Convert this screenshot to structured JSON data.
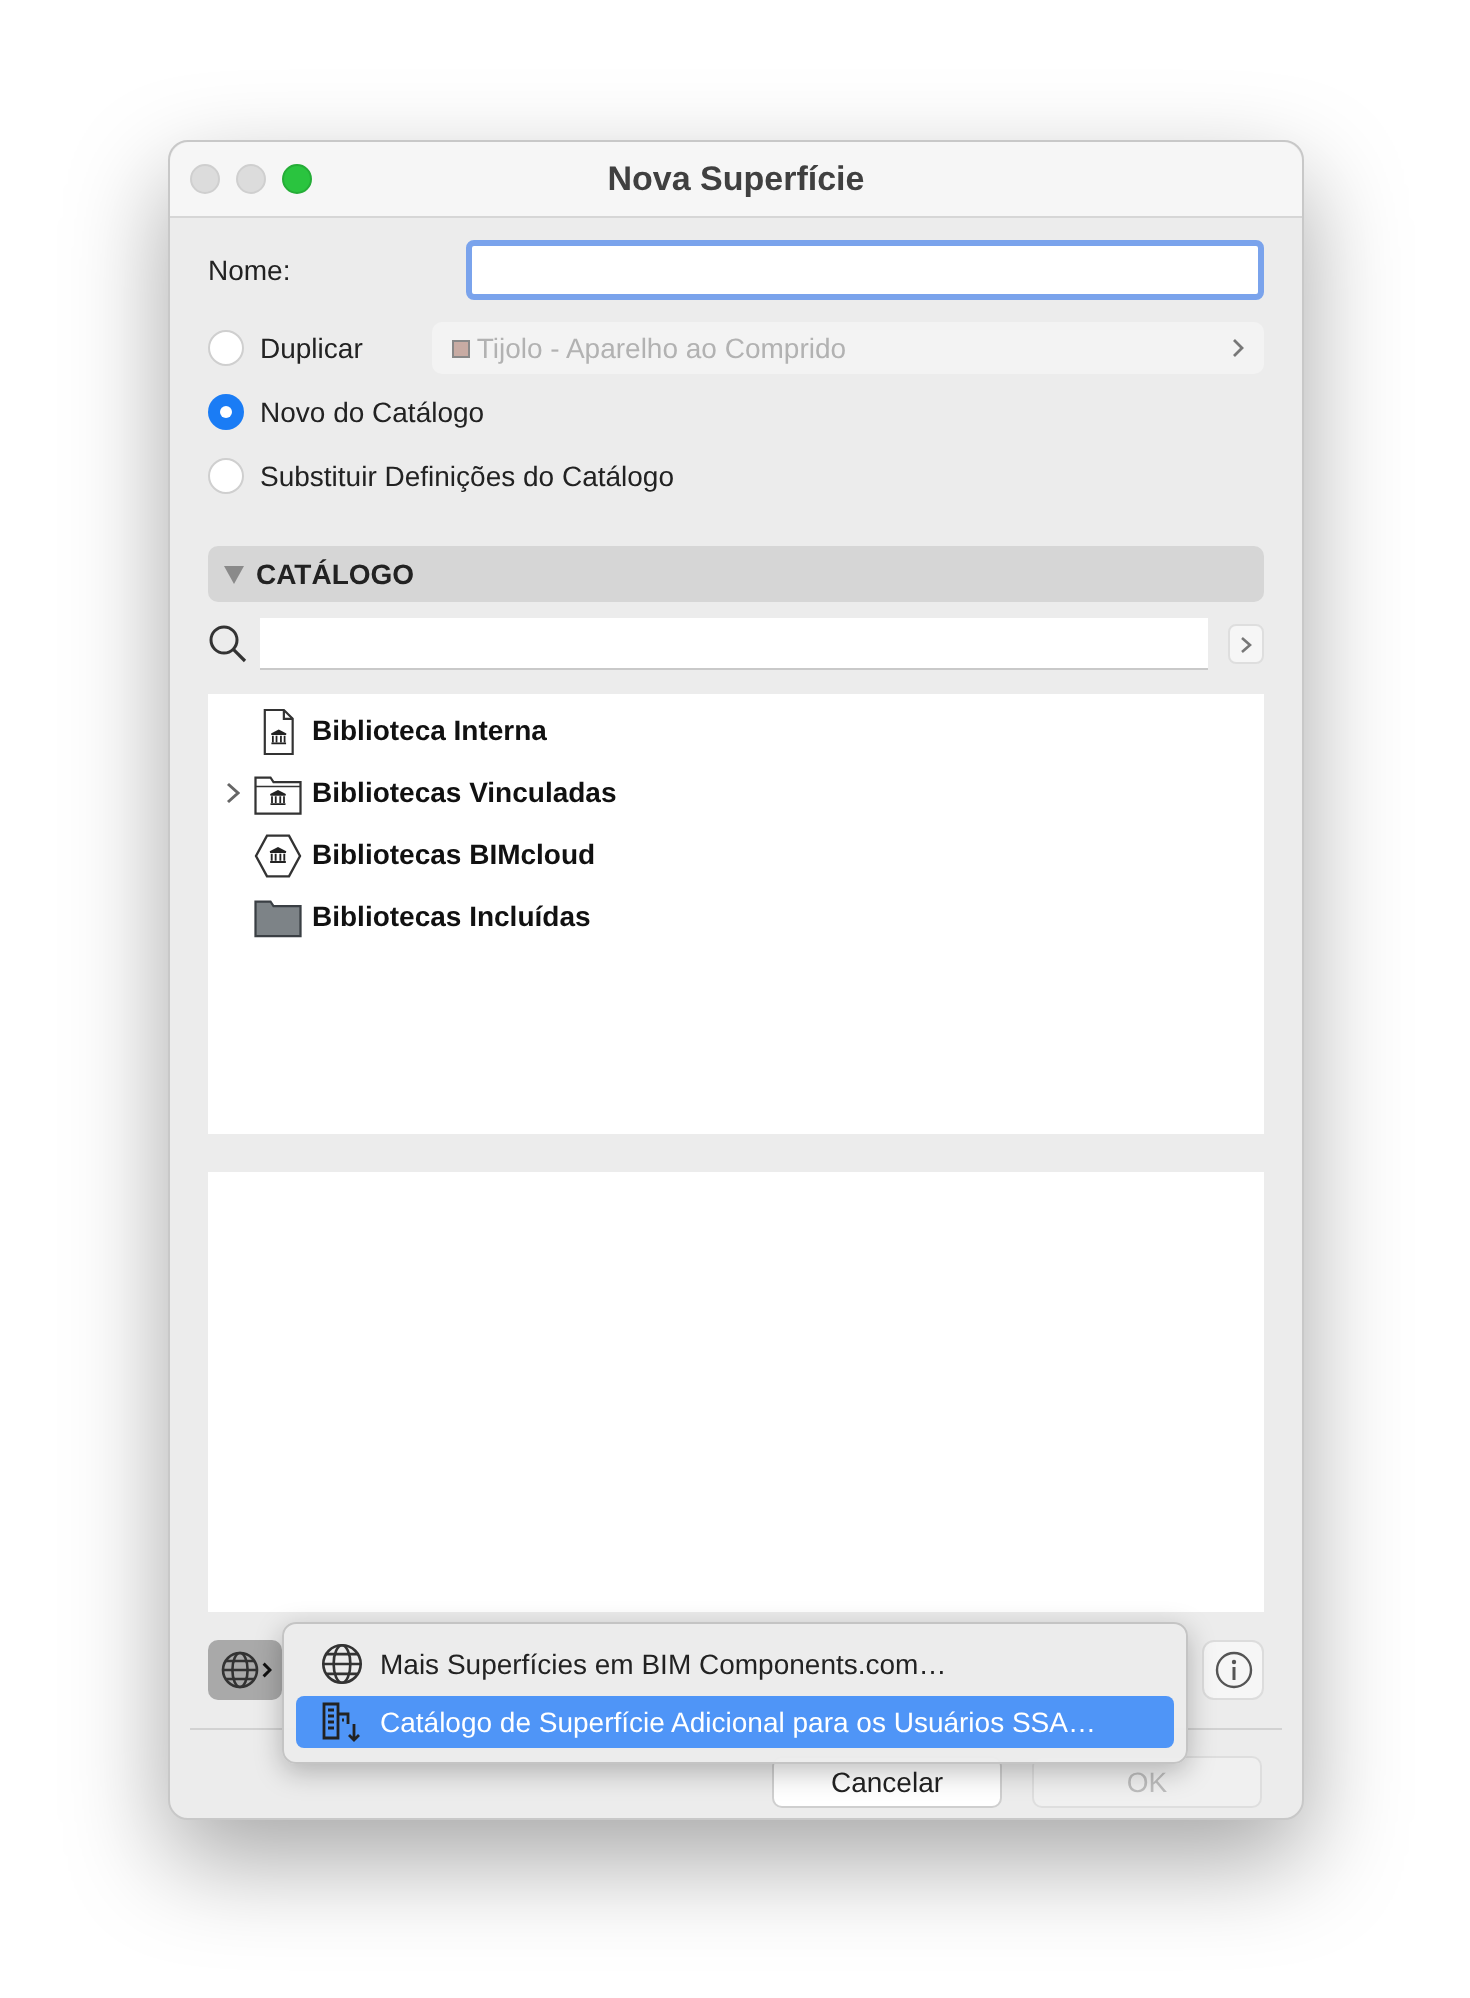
{
  "window": {
    "title": "Nova Superfície"
  },
  "name_field": {
    "label": "Nome:",
    "focused": true
  },
  "options": [
    {
      "label": "Duplicar",
      "selected": false
    },
    {
      "label": "Novo do Catálogo",
      "selected": true
    },
    {
      "label": "Substituir Definições do Catálogo",
      "selected": false
    }
  ],
  "duplicate_select": {
    "value": "Tijolo - Aparelho ao Comprido",
    "color": "#c8aba3",
    "disabled": true
  },
  "catalog": {
    "title": "CATÁLOGO",
    "expanded": true,
    "items": [
      {
        "kind": "document",
        "label": "Biblioteca Interna",
        "expandable": false
      },
      {
        "kind": "linked",
        "label": "Bibliotecas Vinculadas",
        "expandable": true
      },
      {
        "kind": "cloud",
        "label": "Bibliotecas BIMcloud",
        "expandable": false
      },
      {
        "kind": "folder",
        "label": "Bibliotecas Incluídas",
        "expandable": false
      }
    ]
  },
  "menu": {
    "items": [
      {
        "kind": "globe",
        "label": "Mais Superfícies em BIM Components.com…",
        "selected": false
      },
      {
        "kind": "catalog",
        "label": "Catálogo de Superfície Adicional para os Usuários SSA…",
        "selected": true
      }
    ]
  },
  "buttons": [
    {
      "label": "Cancelar",
      "disabled": false
    },
    {
      "label": "OK",
      "disabled": true
    }
  ]
}
